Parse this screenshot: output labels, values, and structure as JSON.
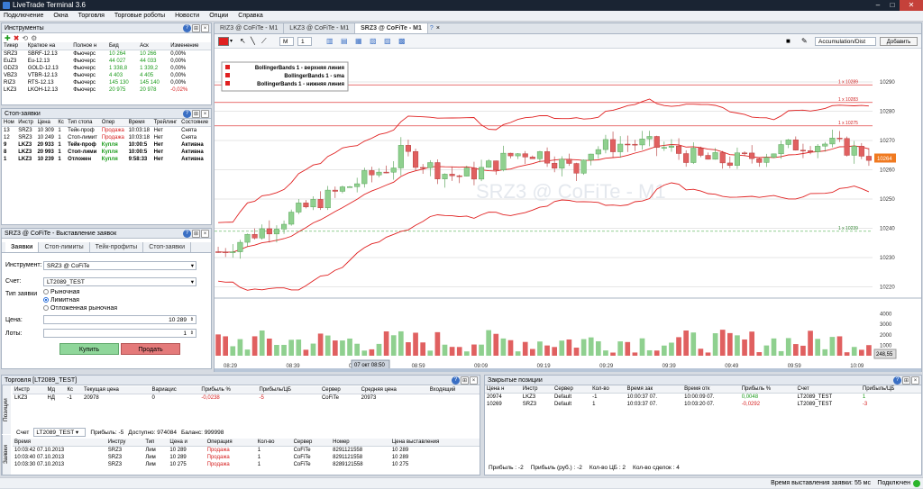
{
  "app": {
    "title": "LiveTrade Terminal 3.6"
  },
  "menu": [
    "Подключение",
    "Окна",
    "Торговля",
    "Торговые роботы",
    "Новости",
    "Опции",
    "Справка"
  ],
  "instruments": {
    "title": "Инструменты",
    "cols": [
      "Тикер",
      "Краткое на",
      "Полное н",
      "Бид",
      "Аск",
      "Изменение"
    ],
    "rows": [
      [
        "SRZ3",
        "SBRF-12.13",
        "Фьючерс",
        "10 264",
        "10 266",
        "0,00%"
      ],
      [
        "EuZ3",
        "Eu-12.13",
        "Фьючерс",
        "44 027",
        "44 033",
        "0,00%"
      ],
      [
        "GDZ3",
        "GOLD-12.13",
        "Фьючерс",
        "1 338,8",
        "1 339,2",
        "0,00%"
      ],
      [
        "VBZ3",
        "VTBR-12.13",
        "Фьючерс",
        "4 403",
        "4 405",
        "0,00%"
      ],
      [
        "RIZ3",
        "RTS-12.13",
        "Фьючерс",
        "145 130",
        "145 140",
        "0,00%"
      ],
      [
        "LKZ3",
        "LKOH-12.13",
        "Фьючерс",
        "20 975",
        "20 978",
        "-0,02%"
      ]
    ]
  },
  "stops": {
    "title": "Стоп-заявки",
    "cols": [
      "Ном",
      "Инстр",
      "Цена",
      "Кс",
      "Тип стопа",
      "Опер",
      "Время",
      "Трейлинг",
      "Состояние"
    ],
    "rows": [
      [
        "13",
        "SRZ3",
        "10 309",
        "1",
        "Тейк-проф",
        "Продажа",
        "10:03:18",
        "Нет",
        "Снята"
      ],
      [
        "12",
        "SRZ3",
        "10 249",
        "1",
        "Стоп-лимит",
        "Продажа",
        "10:03:18",
        "Нет",
        "Снята"
      ],
      [
        "9",
        "LKZ3",
        "20 933",
        "1",
        "Тейк-проф",
        "Купля",
        "10:00:5",
        "Нет",
        "Активна"
      ],
      [
        "8",
        "LKZ3",
        "20 993",
        "1",
        "Стоп-лими",
        "Купля",
        "10:00:5",
        "Нет",
        "Активна"
      ],
      [
        "1",
        "LKZ3",
        "10 239",
        "1",
        "Отложен",
        "Купля",
        "9:58:33",
        "Нет",
        "Активна"
      ]
    ]
  },
  "order": {
    "title": "SRZ3 @ CoFiTe - Выставление заявок",
    "tabs": [
      "Заявки",
      "Стоп-лимиты",
      "Тейк-профиты",
      "Стоп-заявки"
    ],
    "instrument_label": "Инструмент:",
    "instrument": "SRZ3 @ CoFiTe",
    "account_label": "Счет:",
    "account": "LT2089_TEST",
    "type_label": "Тип заявки",
    "types": [
      "Рыночная",
      "Лимитная",
      "Отложенная рыночная"
    ],
    "price_label": "Цена:",
    "price": "10 289",
    "lots_label": "Лоты:",
    "lots": "1",
    "buy": "Купить",
    "sell": "Продать"
  },
  "chart": {
    "tabs": [
      "RIZ3 @ CoFiTe - M1",
      "LKZ3 @ CoFiTe - M1",
      "SRZ3 @ CoFiTe - M1"
    ],
    "watermark": "SRZ3 @ CoFiTe - M1",
    "tf": "M",
    "count": "1",
    "indicator_select": "Accumulation/Dist",
    "add_btn": "Добавить",
    "legend": [
      "BollingerBands 1 - верхняя линия",
      "BollingerBands 1 - sma",
      "BollingerBands 1 - нижняя линия"
    ],
    "levels": [
      "1 x 10289",
      "1 x 10283",
      "1 x 10275",
      "1 x 10239"
    ],
    "price_badge": "10264",
    "vol_badge": "248,55",
    "cursor_time": "07 окт 08:50",
    "y_ticks": [
      "10290",
      "10280",
      "10270",
      "10260",
      "10250",
      "10240",
      "10230",
      "10220"
    ],
    "vol_ticks": [
      "4000",
      "3000",
      "2000",
      "1000"
    ],
    "x_ticks": [
      "08:29",
      "08:39",
      "08:49",
      "08:59",
      "09:09",
      "09:19",
      "09:29",
      "09:39",
      "09:49",
      "09:59",
      "10:09"
    ]
  },
  "chart_data": {
    "type": "candlestick",
    "series": [
      {
        "name": "BollingerBands 1 - верхняя линия"
      },
      {
        "name": "BollingerBands 1 - sma"
      },
      {
        "name": "BollingerBands 1 - нижняя линия"
      }
    ],
    "ylim": [
      10218,
      10298
    ],
    "levels": [
      10289,
      10283,
      10275,
      10239
    ]
  },
  "trading": {
    "title": "Торговля [LT2089_TEST]",
    "side_label1": "Позиции",
    "side_label2": "Заявки",
    "pos_cols": [
      "Инстр",
      "Мд",
      "Кс",
      "Текущая цена",
      "Вариацис",
      "Прибыль %",
      "Прибыль/ЦБ",
      "Сервер",
      "Средняя цена",
      "Входящий"
    ],
    "pos_row": [
      "LKZ3",
      "НД",
      "-1",
      "20978",
      "0",
      "-0,0238",
      "-5",
      "CoFiTe",
      "20973",
      ""
    ],
    "account_label": "Счет",
    "account": "LT2089_TEST",
    "profit": "Прибыль: -5",
    "available": "Доступно: 974084",
    "balance": "Баланс: 999998",
    "ord_cols": [
      "Время",
      "Инстру",
      "Тип",
      "Цена и",
      "Операция",
      "Кол-во",
      "Сервер",
      "Номер",
      "Цена выставления"
    ],
    "ord_rows": [
      [
        "10:03:42 07.10.2013",
        "SRZ3",
        "Лим",
        "10 289",
        "Продажа",
        "1",
        "CoFiTe",
        "8291121558",
        "10 289"
      ],
      [
        "10:03:40 07.10.2013",
        "SRZ3",
        "Лим",
        "10 289",
        "Продажа",
        "1",
        "CoFiTe",
        "8291121558",
        "10 289"
      ],
      [
        "10:03:30 07.10.2013",
        "SRZ3",
        "Лим",
        "10 275",
        "Продажа",
        "1",
        "CoFiTe",
        "8289121558",
        "10 275"
      ]
    ]
  },
  "closed": {
    "title": "Закрытые позиции",
    "cols": [
      "Цена н",
      "Инстр",
      "Сервер",
      "Кол-во",
      "Время зак",
      "Время отк",
      "Прибыль %",
      "Счет",
      "Прибыль/ЦБ"
    ],
    "rows": [
      [
        "20974",
        "LKZ3",
        "Default",
        "-1",
        "10:00:37 07.",
        "10:00:09 07.",
        "0,0048",
        "LT2089_TEST",
        "1"
      ],
      [
        "10269",
        "SRZ3",
        "Default",
        "1",
        "10:03:37 07.",
        "10:03:20 07.",
        "-0,0292",
        "LT2089_TEST",
        "-3"
      ]
    ],
    "footer": {
      "p1": "Прибыль : -2",
      "p2": "Прибыль (руб.) : -2",
      "p3": "Кол-во ЦБ : 2",
      "p4": "Кол-во сделок : 4"
    }
  },
  "status": {
    "text": "Время выставления заявки: 55 мс",
    "conn": "Подключен"
  }
}
